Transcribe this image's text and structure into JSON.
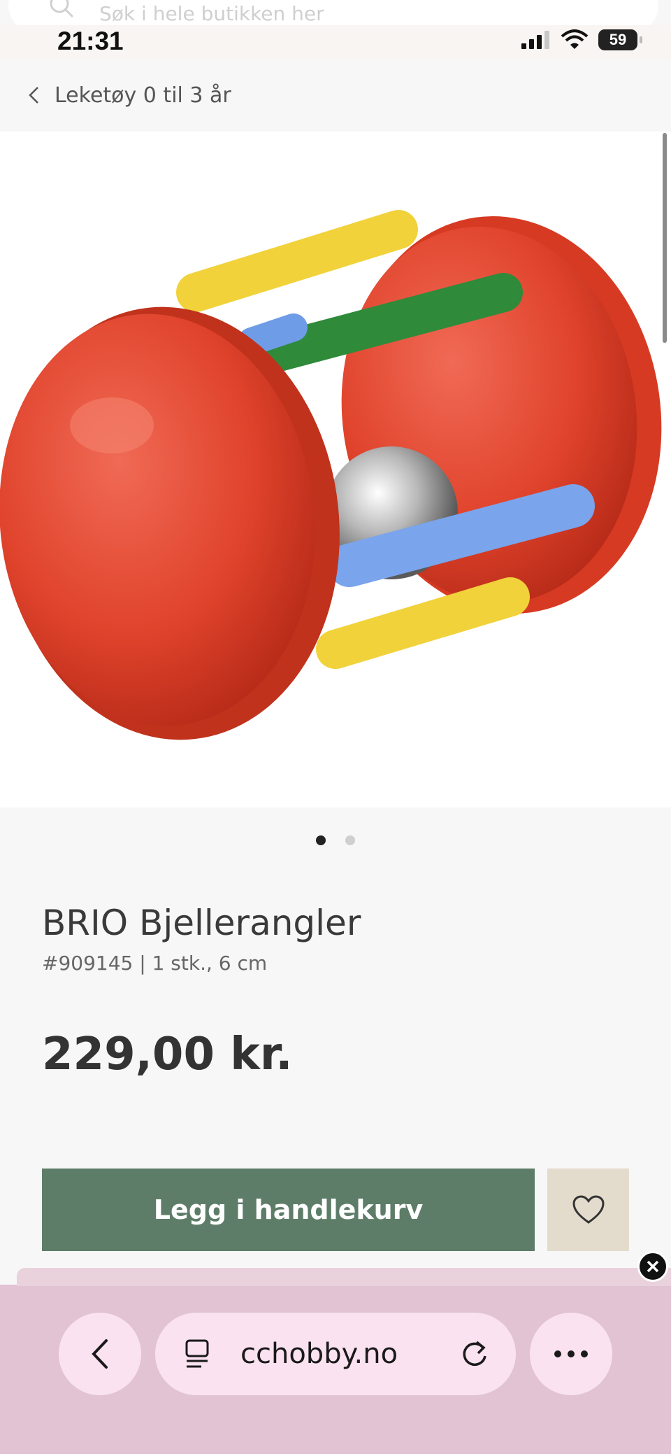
{
  "search": {
    "placeholder": "Søk i hele butikken her"
  },
  "status_bar": {
    "time": "21:31",
    "battery": "59"
  },
  "breadcrumb": {
    "label": "Leketøy 0 til 3 år"
  },
  "product": {
    "name": "BRIO Bjellerangler",
    "meta": "#909145  | 1 stk., 6 cm",
    "price": "229,00 kr.",
    "image_count": 2,
    "active_image": 1
  },
  "actions": {
    "add_to_cart": "Legg i handlekurv"
  },
  "browser": {
    "url": "cchobby.no"
  },
  "colors": {
    "primary_button": "#5e7d69",
    "favorite_button": "#e3dccd",
    "browser_bar": "#e1c3d3",
    "browser_pill": "#fbe2f1"
  }
}
